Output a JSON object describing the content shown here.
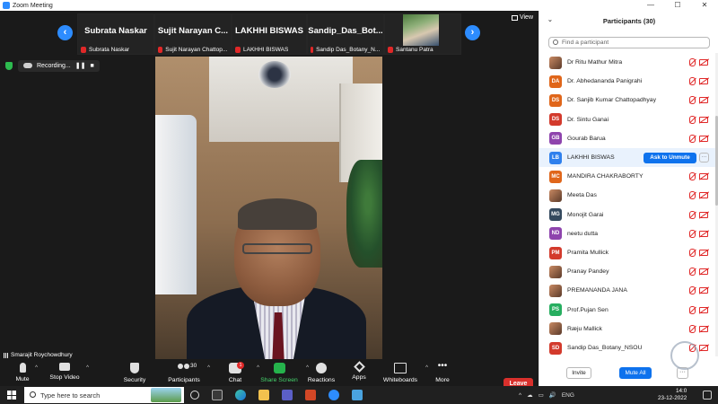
{
  "window": {
    "title": "Zoom Meeting",
    "controls": [
      "—",
      "☐",
      "✕"
    ]
  },
  "strip": {
    "prev_icon": "chevron-left-icon",
    "next_icon": "chevron-right-icon",
    "view_label": "View",
    "thumbnails": [
      {
        "big_name": "Subrata Naskar",
        "small_name": "Subrata Naskar"
      },
      {
        "big_name": "Sujit Narayan C...",
        "small_name": "Sujit Narayan Chattop..."
      },
      {
        "big_name": "LAKHHI BISWAS",
        "small_name": "LAKHHI BISWAS"
      },
      {
        "big_name": "Sandip_Das_Bot...",
        "small_name": "Sandip Das_Botany_N..."
      },
      {
        "big_name": "",
        "small_name": "Santanu Patra"
      }
    ]
  },
  "recording": {
    "label": "Recording...",
    "pause": "❚❚",
    "stop": "■"
  },
  "self_view": {
    "name": "Smarajit Roychowdhury"
  },
  "toolbar": {
    "mute": "Mute",
    "stop_video": "Stop Video",
    "security": "Security",
    "participants": "Participants",
    "participants_count": "30",
    "chat": "Chat",
    "chat_badge": "1",
    "share_screen": "Share Screen",
    "reactions": "Reactions",
    "apps": "Apps",
    "whiteboards": "Whiteboards",
    "more": "More",
    "leave": "Leave",
    "caret": "^"
  },
  "panel": {
    "title": "Participants (30)",
    "search_placeholder": "Find a participant",
    "participants": [
      {
        "initials": "",
        "photo": true,
        "color": "#c0392b",
        "name": "Dr Ritu Mathur Mitra",
        "video": "off"
      },
      {
        "initials": "DA",
        "photo": false,
        "color": "#e0661a",
        "name": "Dr. Abhedananda Panigrahi",
        "video": "off"
      },
      {
        "initials": "DS",
        "photo": false,
        "color": "#e0661a",
        "name": "Dr. Sanjib Kumar Chattopadhyay",
        "video": "off"
      },
      {
        "initials": "DS",
        "photo": false,
        "color": "#d33a2c",
        "name": "Dr. Sintu Ganai",
        "video": "off"
      },
      {
        "initials": "GB",
        "photo": false,
        "color": "#8e44ad",
        "name": "Gourab Barua",
        "video": "off"
      },
      {
        "initials": "LB",
        "photo": false,
        "color": "#2f80ed",
        "name": "LAKHHI BISWAS",
        "video": "ask"
      },
      {
        "initials": "MC",
        "photo": false,
        "color": "#e0661a",
        "name": "MANDIRA CHAKRABORTY",
        "video": "off"
      },
      {
        "initials": "",
        "photo": true,
        "color": "#c98a63",
        "name": "Meeta Das",
        "video": "off"
      },
      {
        "initials": "MG",
        "photo": false,
        "color": "#34495e",
        "name": "Monojit Garai",
        "video": "off"
      },
      {
        "initials": "ND",
        "photo": false,
        "color": "#8e44ad",
        "name": "neetu dutta",
        "video": "off"
      },
      {
        "initials": "PM",
        "photo": false,
        "color": "#d33a2c",
        "name": "Pramita Mullick",
        "video": "off"
      },
      {
        "initials": "",
        "photo": true,
        "color": "#7a5b4a",
        "name": "Pranay Pandey",
        "video": "off"
      },
      {
        "initials": "",
        "photo": true,
        "color": "#6d4c3d",
        "name": "PREMANANDA JANA",
        "video": "off"
      },
      {
        "initials": "PS",
        "photo": false,
        "color": "#27ae60",
        "name": "Prof.Pujan Sen",
        "video": "off"
      },
      {
        "initials": "",
        "photo": true,
        "color": "#a47d5a",
        "name": "Ræju Mallick",
        "video": "off"
      },
      {
        "initials": "SD",
        "photo": false,
        "color": "#d33a2c",
        "name": "Sandip Das_Botany_NSOU",
        "video": "off"
      }
    ],
    "ask_to_unmute": "Ask to Unmute",
    "row_more": "···",
    "invite": "Invite",
    "mute_all": "Mute All",
    "more": "···"
  },
  "taskbar": {
    "search_placeholder": "Type here to search",
    "tray_icons": [
      "^",
      "☁",
      "▭",
      "🔊"
    ],
    "lang": "ENG",
    "time": "14:0",
    "date": "23-12-2022"
  }
}
